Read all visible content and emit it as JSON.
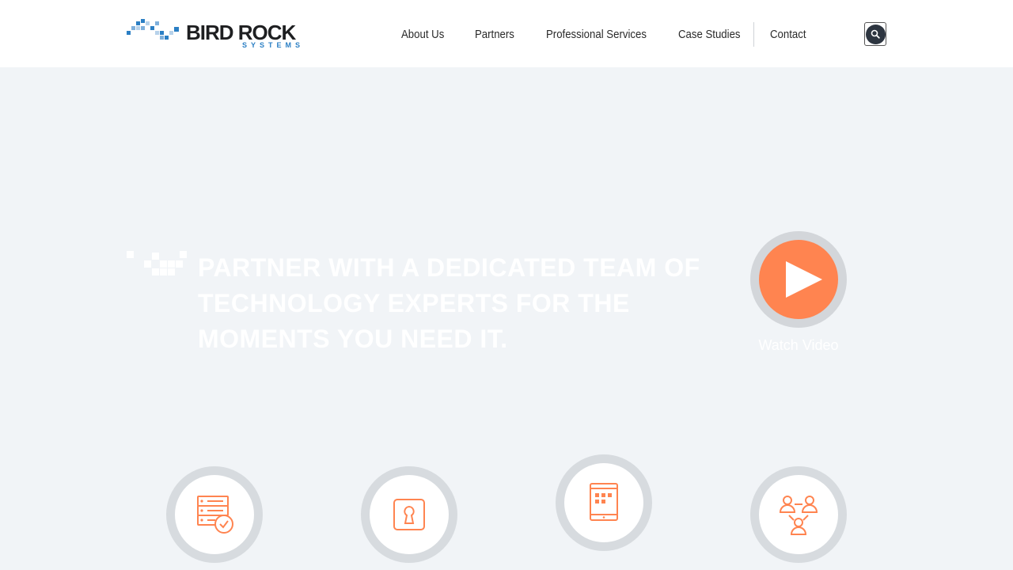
{
  "brand": {
    "name": "BIRD ROCK",
    "subname": "SYSTEMS",
    "primary_color": "#2b7fc4",
    "accent_color": "#ff8450"
  },
  "nav": {
    "items": [
      {
        "label": "About Us"
      },
      {
        "label": "Partners"
      },
      {
        "label": "Professional Services"
      },
      {
        "label": "Case Studies"
      },
      {
        "label": "Contact"
      }
    ],
    "search_icon": "search-icon"
  },
  "hero": {
    "lines": [
      "PARTNER WITH A DEDICATED TEAM OF",
      "TECHNOLOGY EXPERTS FOR THE",
      "MOMENTS YOU NEED IT."
    ],
    "video_label": "Watch Video",
    "play_icon": "play-icon"
  },
  "features": [
    {
      "icon": "server-check-icon"
    },
    {
      "icon": "keyhole-lock-icon"
    },
    {
      "icon": "tablet-grid-icon"
    },
    {
      "icon": "network-people-icon"
    }
  ]
}
